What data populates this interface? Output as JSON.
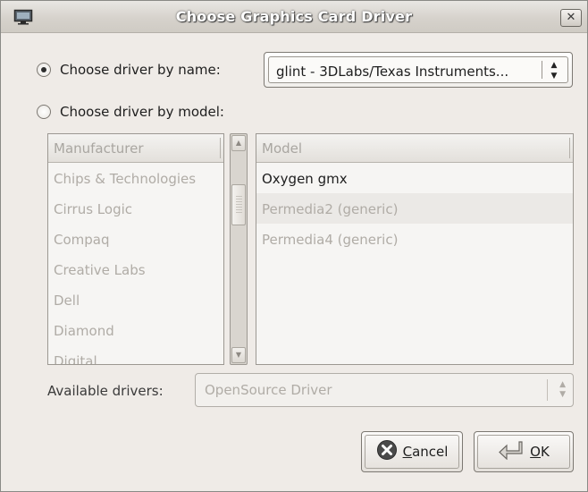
{
  "window": {
    "title": "Choose Graphics Card Driver",
    "close_glyph": "✕"
  },
  "options": {
    "by_name_label": "Choose driver by name:",
    "by_model_label": "Choose driver by model:",
    "selected": "by_name"
  },
  "driver_combo": {
    "value": "glint - 3DLabs/Texas Instruments..."
  },
  "manufacturer_list": {
    "header": "Manufacturer",
    "items": [
      "Chips & Technologies",
      "Cirrus Logic",
      "Compaq",
      "Creative Labs",
      "Dell",
      "Diamond",
      "Digital"
    ]
  },
  "model_list": {
    "header": "Model",
    "items": [
      "Oxygen gmx",
      "Permedia2 (generic)",
      "Permedia4 (generic)"
    ]
  },
  "available_drivers": {
    "label": "Available drivers:",
    "value": "OpenSource Driver"
  },
  "buttons": {
    "cancel_mnemonic": "C",
    "cancel_rest": "ancel",
    "ok_mnemonic": "O",
    "ok_rest": "K"
  },
  "icons": {
    "window": "monitor-icon",
    "cancel": "cancel-icon",
    "ok": "enter-icon"
  }
}
